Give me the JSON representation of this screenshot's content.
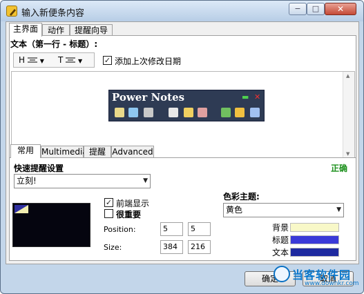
{
  "window": {
    "title": "输入新便条内容",
    "minimize_glyph": "−",
    "maximize_glyph": "□",
    "close_glyph": "✕"
  },
  "tabs": [
    {
      "label": "主界面",
      "active": true
    },
    {
      "label": "动作",
      "active": false
    },
    {
      "label": "提醒向导",
      "active": false
    }
  ],
  "text_section": {
    "label": "文本（第一行 - 标题）:",
    "toolbar": {
      "h_label": "H",
      "h_icon": "align-icon",
      "t_label": "T",
      "t_icon": "align-icon"
    },
    "append_date_label": "添加上次修改日期",
    "append_date_checked": true
  },
  "power_notes": {
    "title": "Power Notes",
    "min_glyph": "▬",
    "close_glyph": "✕"
  },
  "inner_tabs": [
    {
      "label": "常用",
      "active": true
    },
    {
      "label": "Multimedia",
      "active": false
    },
    {
      "label": "提醒",
      "active": false
    },
    {
      "label": "Advanced",
      "active": false
    }
  ],
  "quick_reminder": {
    "label": "快速提醒设置",
    "status": "正确",
    "status_color": "#1a8f1a",
    "selected": "立刻!"
  },
  "options": {
    "on_top_label": "前端显示",
    "on_top_checked": true,
    "important_label": "很重要",
    "important_checked": false
  },
  "position": {
    "label": "Position:",
    "x": "5",
    "y": "5"
  },
  "size": {
    "label": "Size:",
    "w": "384",
    "h": "216"
  },
  "color_theme": {
    "label": "色彩主题:",
    "selected": "黄色",
    "items": [
      {
        "label": "背景",
        "color": "#f8f8c8"
      },
      {
        "label": "标题",
        "color": "#3a3ad8"
      },
      {
        "label": "文本",
        "color": "#1e2aa0"
      }
    ]
  },
  "buttons": {
    "ok": "确定",
    "cancel": "取消"
  },
  "watermark": {
    "name": "当客软件园",
    "url": "www.downkr.com"
  }
}
